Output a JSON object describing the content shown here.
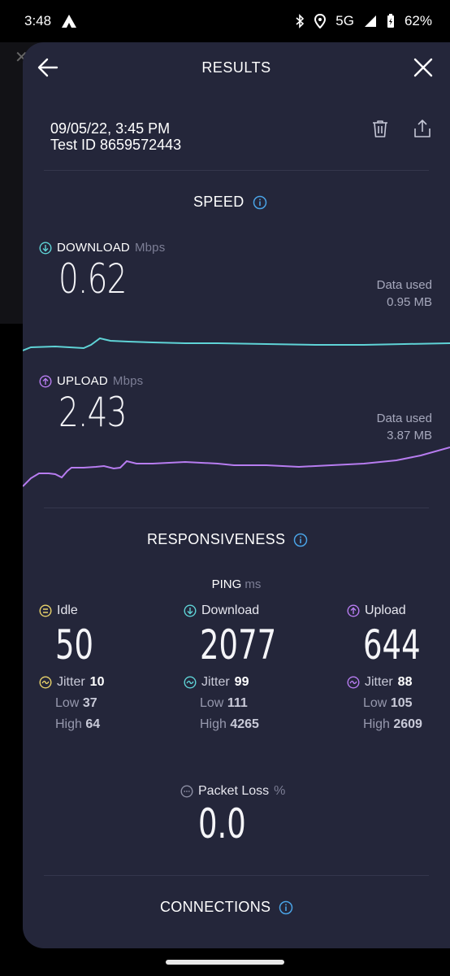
{
  "status_bar": {
    "time": "3:48",
    "network": "5G",
    "battery": "62%"
  },
  "header": {
    "title": "RESULTS"
  },
  "test": {
    "datetime": "09/05/22, 3:45 PM",
    "test_id": "Test ID 8659572443"
  },
  "speed": {
    "title": "SPEED",
    "download": {
      "label": "DOWNLOAD",
      "unit": "Mbps",
      "value": "0.62",
      "data_used_label": "Data used",
      "data_used_value": "0.95 MB",
      "color": "#5fd3d6"
    },
    "upload": {
      "label": "UPLOAD",
      "unit": "Mbps",
      "value": "2.43",
      "data_used_label": "Data used",
      "data_used_value": "3.87 MB",
      "color": "#b77cf0"
    }
  },
  "responsiveness": {
    "title": "RESPONSIVENESS",
    "ping_label": "PING",
    "ping_unit": "ms",
    "idle": {
      "label": "Idle",
      "value": "50",
      "jitter_label": "Jitter",
      "jitter": "10",
      "low_label": "Low",
      "low": "37",
      "high_label": "High",
      "high": "64",
      "color": "#e8d26a"
    },
    "download": {
      "label": "Download",
      "value": "2077",
      "jitter_label": "Jitter",
      "jitter": "99",
      "low_label": "Low",
      "low": "111",
      "high_label": "High",
      "high": "4265",
      "color": "#5fd3d6"
    },
    "upload": {
      "label": "Upload",
      "value": "644",
      "jitter_label": "Jitter",
      "jitter": "88",
      "low_label": "Low",
      "low": "105",
      "high_label": "High",
      "high": "2609",
      "color": "#b77cf0"
    },
    "packet_loss": {
      "label": "Packet Loss",
      "unit": "%",
      "value": "0.0"
    }
  },
  "connections": {
    "title": "CONNECTIONS"
  },
  "colors": {
    "sheet_bg": "#24263a",
    "info_icon": "#4aa3e6"
  }
}
